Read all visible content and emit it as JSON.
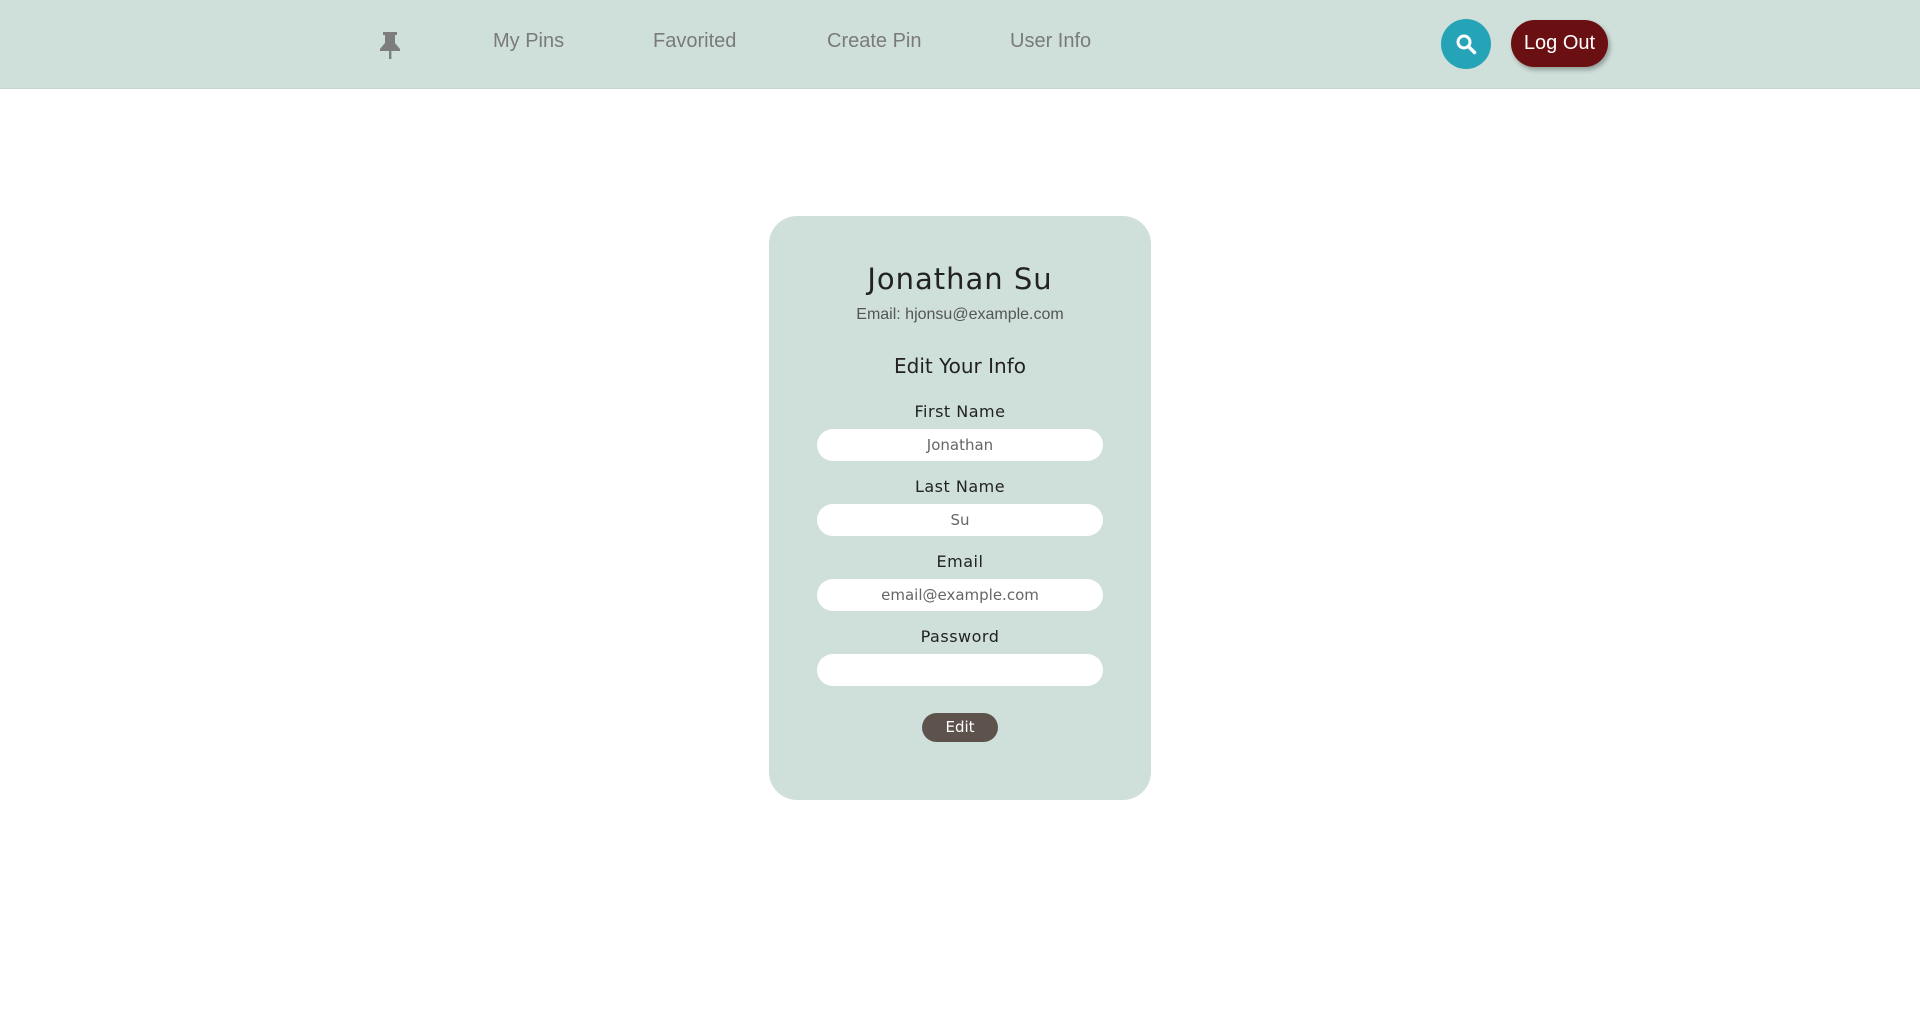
{
  "nav": {
    "logo_icon": "pushpin-icon",
    "links": [
      {
        "label": "My Pins"
      },
      {
        "label": "Favorited"
      },
      {
        "label": "Create Pin"
      },
      {
        "label": "User Info"
      }
    ],
    "search_icon": "search-icon",
    "logout_label": "Log Out"
  },
  "profile": {
    "name": "Jonathan Su",
    "email_line": "Email: hjonsu@example.com"
  },
  "form": {
    "title": "Edit Your Info",
    "fields": [
      {
        "label": "First Name",
        "value": "",
        "placeholder": "Jonathan"
      },
      {
        "label": "Last Name",
        "value": "",
        "placeholder": "Su"
      },
      {
        "label": "Email",
        "value": "",
        "placeholder": "email@example.com"
      },
      {
        "label": "Password",
        "value": "",
        "placeholder": ""
      }
    ],
    "submit_label": "Edit"
  },
  "colors": {
    "nav_bg": "#cfe0da",
    "card_bg": "#cfe0da",
    "search_button": "#25a4b7",
    "logout_button": "#6a0f12",
    "edit_button": "#5e534c"
  }
}
